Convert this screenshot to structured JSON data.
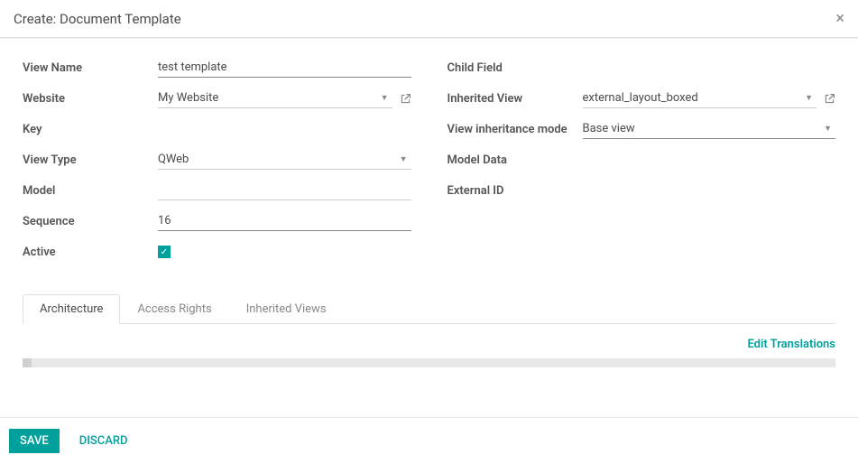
{
  "header": {
    "title": "Create: Document Template"
  },
  "form": {
    "left": {
      "view_name": {
        "label": "View Name",
        "value": "test template"
      },
      "website": {
        "label": "Website",
        "value": "My Website"
      },
      "key": {
        "label": "Key",
        "value": ""
      },
      "view_type": {
        "label": "View Type",
        "value": "QWeb"
      },
      "model": {
        "label": "Model",
        "value": ""
      },
      "sequence": {
        "label": "Sequence",
        "value": "16"
      },
      "active": {
        "label": "Active",
        "checked": true
      }
    },
    "right": {
      "child_field": {
        "label": "Child Field",
        "value": ""
      },
      "inherited_view": {
        "label": "Inherited View",
        "value": "external_layout_boxed"
      },
      "view_inheritance_mode": {
        "label": "View inheritance mode",
        "value": "Base view"
      },
      "model_data": {
        "label": "Model Data",
        "value": ""
      },
      "external_id": {
        "label": "External ID",
        "value": ""
      }
    }
  },
  "tabs": {
    "architecture": "Architecture",
    "access_rights": "Access Rights",
    "inherited_views": "Inherited Views"
  },
  "tab_content": {
    "edit_translations": "Edit Translations"
  },
  "footer": {
    "save": "SAVE",
    "discard": "DISCARD"
  }
}
